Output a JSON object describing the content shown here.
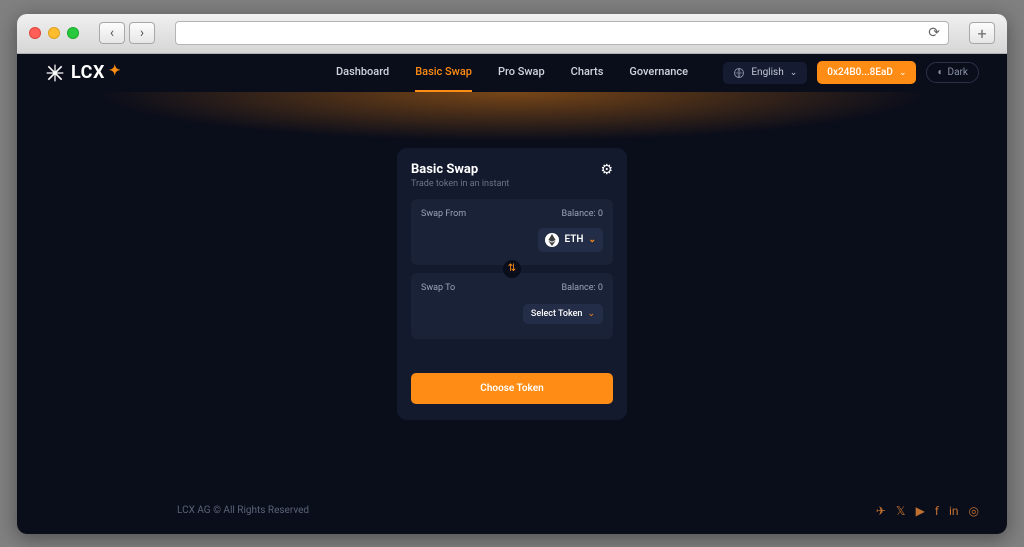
{
  "logo_text": "LCX",
  "nav": {
    "dashboard": "Dashboard",
    "basic_swap": "Basic Swap",
    "pro_swap": "Pro Swap",
    "charts": "Charts",
    "governance": "Governance"
  },
  "language": "English",
  "wallet_address": "0x24B0...8EaD",
  "theme_label": "Dark",
  "swap": {
    "title": "Basic Swap",
    "subtitle": "Trade token in an instant",
    "from_label": "Swap From",
    "from_balance": "Balance: 0",
    "from_token": "ETH",
    "to_label": "Swap To",
    "to_balance": "Balance: 0",
    "select_token": "Select Token",
    "action": "Choose Token"
  },
  "footer_text": "LCX AG © All Rights Reserved"
}
